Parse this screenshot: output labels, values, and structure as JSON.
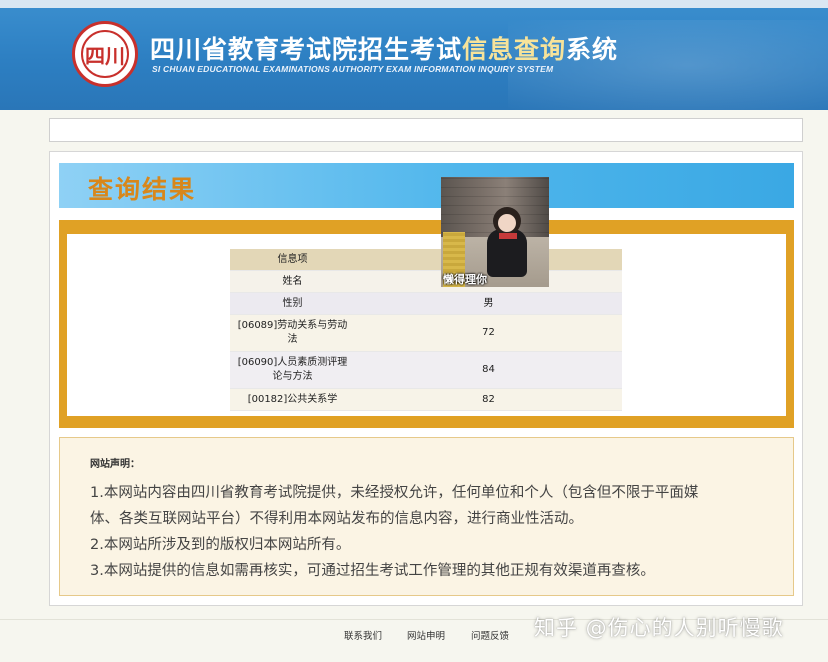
{
  "header": {
    "logo_text": "四川",
    "title_main": "四川省教育考试院招生考试",
    "title_accent": "信息查询",
    "title_tail": "系统",
    "subtitle": "SI CHUAN EDUCATIONAL EXAMINATIONS AUTHORITY EXAM INFORMATION INQUIRY SYSTEM"
  },
  "result": {
    "title": "查询结果",
    "photo_caption": "懒得理你",
    "table": {
      "header": "信息项",
      "rows": [
        {
          "label": "姓名",
          "value": ""
        },
        {
          "label": "性别",
          "value": "男"
        },
        {
          "label": "[06089]劳动关系与劳动法",
          "value": "72"
        },
        {
          "label": "[06090]人员素质测评理论与方法",
          "value": "84"
        },
        {
          "label": "[00182]公共关系学",
          "value": "82"
        }
      ]
    }
  },
  "notice": {
    "title": "网站声明：",
    "lines": [
      "1.本网站内容由四川省教育考试院提供，未经授权允许，任何单位和个人（包含但不限于平面媒",
      "体、各类互联网站平台）不得利用本网站发布的信息内容，进行商业性活动。",
      "2.本网站所涉及到的版权归本网站所有。",
      "3.本网站提供的信息如需再核实，可通过招生考试工作管理的其他正规有效渠道再查核。"
    ]
  },
  "footer": {
    "links": [
      "联系我们",
      "网站申明",
      "问题反馈"
    ]
  },
  "watermark": "知乎 @伤心的人别听慢歌"
}
